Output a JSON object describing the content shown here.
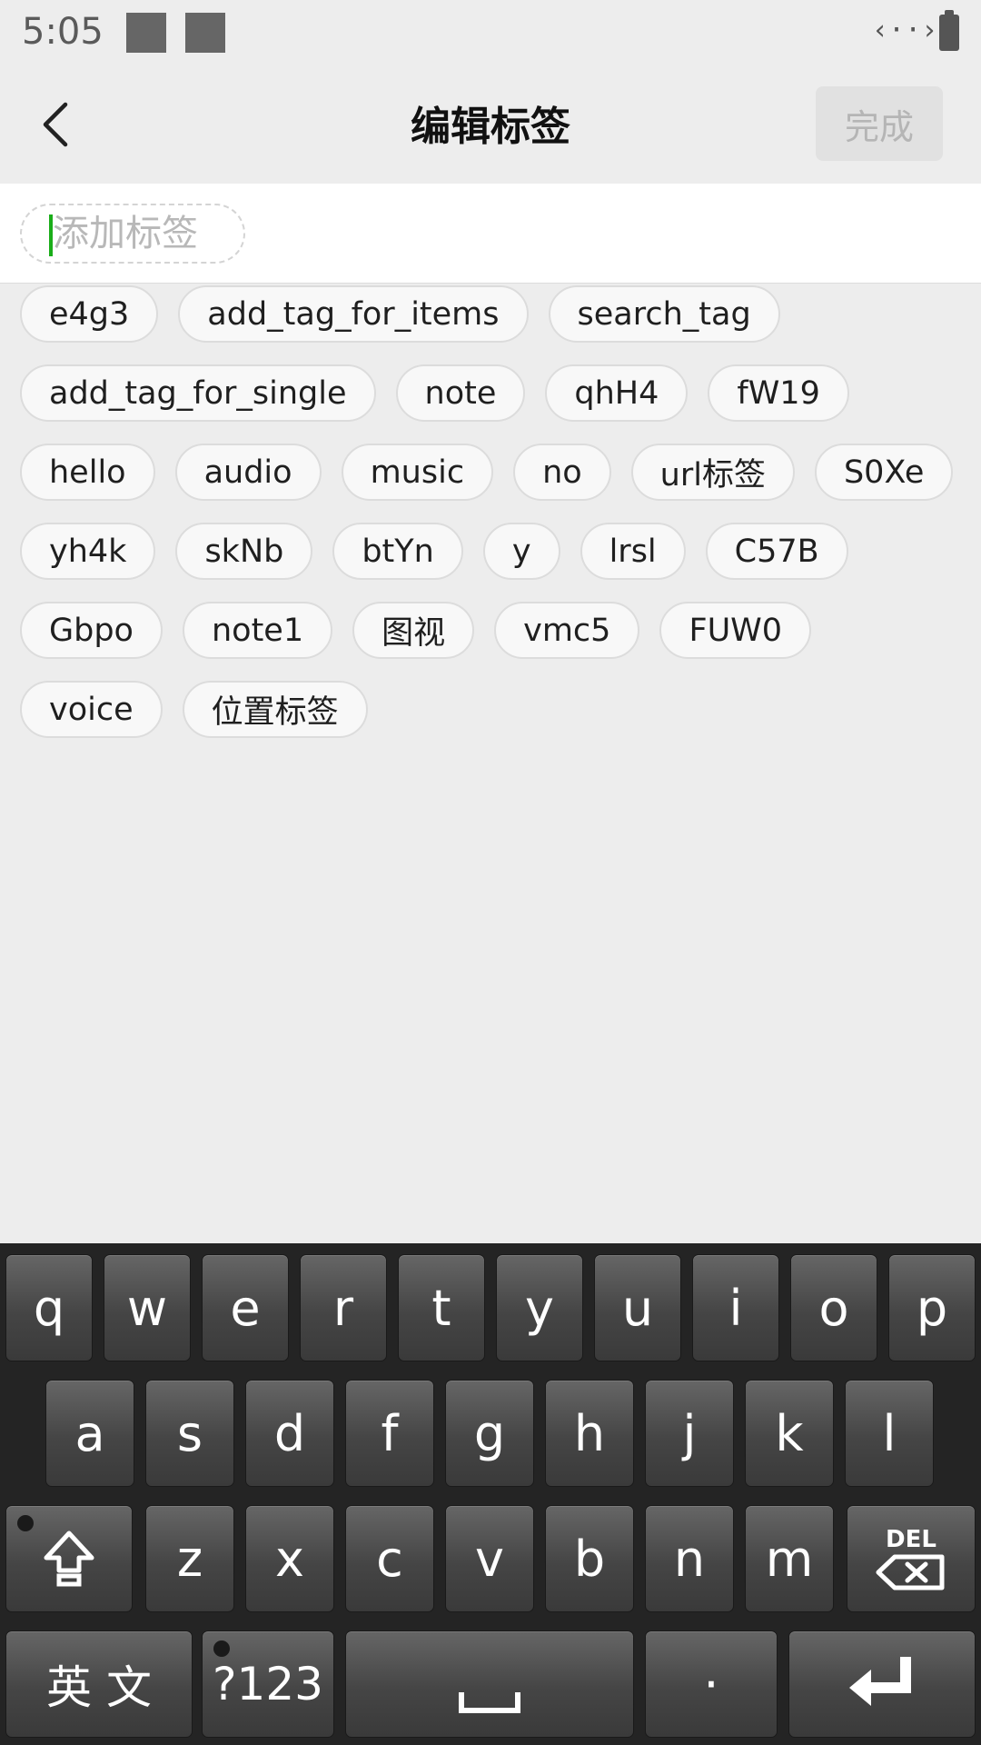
{
  "status_bar": {
    "time": "5:05",
    "code_glyph": "‹··›"
  },
  "header": {
    "title": "编辑标签",
    "done_label": "完成"
  },
  "input": {
    "placeholder": "添加标签",
    "value": ""
  },
  "tags": [
    "e4g3",
    "add_tag_for_items",
    "search_tag",
    "add_tag_for_single",
    "note",
    "qhH4",
    "fW19",
    "hello",
    "audio",
    "music",
    "no",
    "url标签",
    "S0Xe",
    "yh4k",
    "skNb",
    "btYn",
    "y",
    "lrsl",
    "C57B",
    "Gbpo",
    "note1",
    "图视",
    "vmc5",
    "FUW0",
    "voice",
    "位置标签"
  ],
  "keyboard": {
    "row1": [
      "q",
      "w",
      "e",
      "r",
      "t",
      "y",
      "u",
      "i",
      "o",
      "p"
    ],
    "row2": [
      "a",
      "s",
      "d",
      "f",
      "g",
      "h",
      "j",
      "k",
      "l"
    ],
    "row3": [
      "z",
      "x",
      "c",
      "v",
      "b",
      "n",
      "m"
    ],
    "del_label": "DEL",
    "lang_label": "英 文",
    "symbols_label": "?123",
    "period_label": "·",
    "shift_icon": "shift-arrow-icon",
    "enter_icon": "enter-arrow-icon",
    "space_icon": "space-bar-icon"
  }
}
